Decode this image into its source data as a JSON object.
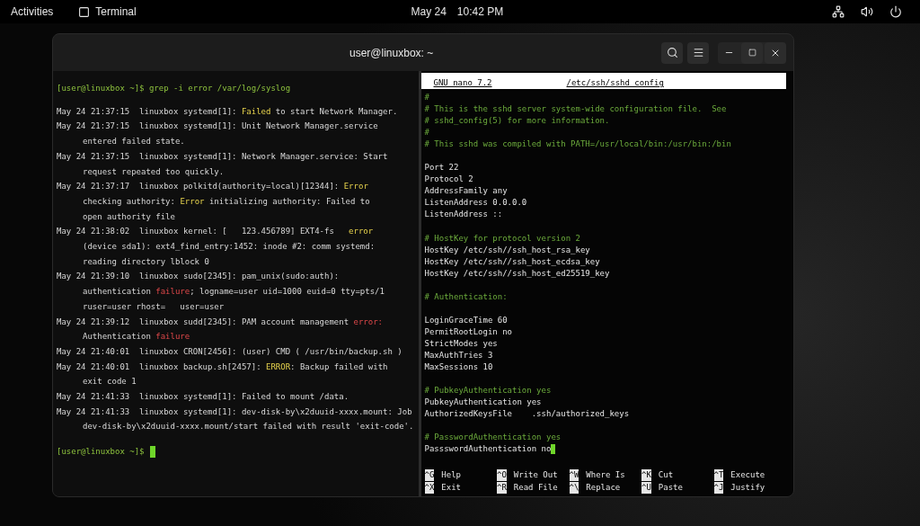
{
  "top_bar": {
    "activities": "Activities",
    "app": "Terminal",
    "date": "May 24",
    "time": "10:42 PM"
  },
  "window": {
    "title": "user@linuxbox: ~"
  },
  "left_pane": {
    "command_prompt": "[user@linuxbox ~]$",
    "command": "grep -i error /var/log/syslog",
    "log_lines": [
      {
        "indent": false,
        "segments": [
          {
            "text": "May 24 21:37:15  linuxbox systemd[1]: ",
            "kind": "plain"
          },
          {
            "text": "Failed",
            "kind": "warning"
          },
          {
            "text": " to start Network Manager.",
            "kind": "plain"
          }
        ]
      },
      {
        "indent": false,
        "segments": [
          {
            "text": "May 24 21:37:15  linuxbox systemd[1]: Unit Network Manager.service",
            "kind": "plain"
          }
        ]
      },
      {
        "indent": true,
        "segments": [
          {
            "text": "entered failed state.",
            "kind": "plain"
          }
        ]
      },
      {
        "indent": false,
        "segments": [
          {
            "text": "May 24 21:37:15  linuxbox systemd[1]: Network Manager.service: Start",
            "kind": "plain"
          }
        ]
      },
      {
        "indent": true,
        "segments": [
          {
            "text": "request repeated too quickly.",
            "kind": "plain"
          }
        ]
      },
      {
        "indent": false,
        "segments": [
          {
            "text": "May 24 21:37:17  linuxbox polkitd(authority=local)[12344]: ",
            "kind": "plain"
          },
          {
            "text": "Error",
            "kind": "warning"
          }
        ]
      },
      {
        "indent": true,
        "segments": [
          {
            "text": "checking authority: ",
            "kind": "plain"
          },
          {
            "text": "Error",
            "kind": "warning"
          },
          {
            "text": " initializing authority: Failed to",
            "kind": "plain"
          }
        ]
      },
      {
        "indent": true,
        "segments": [
          {
            "text": "open authority file",
            "kind": "plain"
          }
        ]
      },
      {
        "indent": false,
        "segments": [
          {
            "text": "May 24 21:38:02  linuxbox kernel: [   123.456789] EXT4-fs   ",
            "kind": "plain"
          },
          {
            "text": "error",
            "kind": "warning"
          }
        ]
      },
      {
        "indent": true,
        "segments": [
          {
            "text": "(device sda1): ext4_find_entry:1452: inode #2: comm systemd:",
            "kind": "plain"
          }
        ]
      },
      {
        "indent": true,
        "segments": [
          {
            "text": "reading directory lblock 0",
            "kind": "plain"
          }
        ]
      },
      {
        "indent": false,
        "segments": [
          {
            "text": "May 24 21:39:10  linuxbox sudo[2345]: pam_unix(sudo:auth):",
            "kind": "plain"
          }
        ]
      },
      {
        "indent": true,
        "segments": [
          {
            "text": "authentication ",
            "kind": "plain"
          },
          {
            "text": "failure",
            "kind": "error"
          },
          {
            "text": "; logname=user uid=1000 euid=0 tty=pts/1",
            "kind": "plain"
          }
        ]
      },
      {
        "indent": true,
        "segments": [
          {
            "text": "ruser=user rhost=   user=user",
            "kind": "plain"
          }
        ]
      },
      {
        "indent": false,
        "segments": [
          {
            "text": "May 24 21:39:12  linuxbox sudd[2345]: PAM account management ",
            "kind": "plain"
          },
          {
            "text": "error:",
            "kind": "error"
          }
        ]
      },
      {
        "indent": true,
        "segments": [
          {
            "text": "Authentication ",
            "kind": "plain"
          },
          {
            "text": "failure",
            "kind": "error"
          }
        ]
      },
      {
        "indent": false,
        "segments": [
          {
            "text": "May 24 21:40:01  linuxbox CRON[2456]: (user) CMD ( /usr/bin/backup.sh )",
            "kind": "plain"
          }
        ]
      },
      {
        "indent": false,
        "segments": [
          {
            "text": "May 24 21:40:01  linuxbox backup.sh[2457]: ",
            "kind": "plain"
          },
          {
            "text": "ERROR",
            "kind": "warning"
          },
          {
            "text": ": Backup failed with",
            "kind": "plain"
          }
        ]
      },
      {
        "indent": true,
        "segments": [
          {
            "text": "exit code 1",
            "kind": "plain"
          }
        ]
      },
      {
        "indent": false,
        "segments": [
          {
            "text": "May 24 21:41:33  linuxbox systemd[1]: Failed to mount /data.",
            "kind": "plain"
          }
        ]
      },
      {
        "indent": false,
        "segments": [
          {
            "text": "May 24 21:41:33  linuxbox systemd[1]: dev-disk-by\\x2duuid-xxxx.mount: Job",
            "kind": "plain"
          }
        ]
      },
      {
        "indent": true,
        "segments": [
          {
            "text": "dev-disk-by\\x2duuid-xxxx.mount/start failed with result 'exit-code'.",
            "kind": "plain"
          }
        ]
      }
    ],
    "final_prompt": "[user@linuxbox ~]$"
  },
  "right_pane": {
    "editor": "GNU nano 7.2",
    "file": "/etc/ssh/sshd_config",
    "lines": [
      {
        "kind": "comment",
        "text": "#"
      },
      {
        "kind": "comment",
        "text": "# This is the sshd server system-wide configuration file.  See"
      },
      {
        "kind": "comment",
        "text": "# sshd_config(5) for more information."
      },
      {
        "kind": "comment",
        "text": "#"
      },
      {
        "kind": "comment",
        "text": "# This sshd was compiled with PATH=/usr/local/bin:/usr/bin:/bin"
      },
      {
        "kind": "blank"
      },
      {
        "kind": "setting",
        "text": "Port 22"
      },
      {
        "kind": "setting",
        "text": "Protocol 2"
      },
      {
        "kind": "setting",
        "text": "AddressFamily any"
      },
      {
        "kind": "setting",
        "text": "ListenAddress 0.0.0.0"
      },
      {
        "kind": "setting",
        "text": "ListenAddress ::"
      },
      {
        "kind": "blank"
      },
      {
        "kind": "comment",
        "text": "# HostKey for protocol version 2"
      },
      {
        "kind": "setting",
        "text": "HostKey /etc/ssh//ssh_host_rsa_key"
      },
      {
        "kind": "setting",
        "text": "HostKey /etc/ssh//ssh_host_ecdsa_key"
      },
      {
        "kind": "setting",
        "text": "HostKey /etc/ssh//ssh_host_ed25519_key"
      },
      {
        "kind": "blank"
      },
      {
        "kind": "comment",
        "text": "# Authentication:"
      },
      {
        "kind": "blank"
      },
      {
        "kind": "setting",
        "text": "LoginGraceTime 60"
      },
      {
        "kind": "setting",
        "text": "PermitRootLogin no"
      },
      {
        "kind": "setting",
        "text": "StrictModes yes"
      },
      {
        "kind": "setting",
        "text": "MaxAuthTries 3"
      },
      {
        "kind": "setting",
        "text": "MaxSessions 10"
      },
      {
        "kind": "blank"
      },
      {
        "kind": "comment",
        "text": "# PubkeyAuthentication yes"
      },
      {
        "kind": "setting",
        "text": "PubkeyAuthentication yes"
      },
      {
        "kind": "setting",
        "text": "AuthorizedKeysFile    .ssh/authorized_keys"
      },
      {
        "kind": "blank"
      },
      {
        "kind": "comment",
        "text": "# PasswordAuthentication yes"
      },
      {
        "kind": "cursor",
        "text": "PassswordAuthentication no"
      }
    ],
    "shortcuts": [
      [
        {
          "key": "^G",
          "label": "Help"
        },
        {
          "key": "^O",
          "label": "Write Out"
        },
        {
          "key": "^W",
          "label": "Where Is"
        },
        {
          "key": "^K",
          "label": "Cut"
        },
        {
          "key": "^T",
          "label": "Execute"
        }
      ],
      [
        {
          "key": "^X",
          "label": "Exit"
        },
        {
          "key": "^R",
          "label": "Read File"
        },
        {
          "key": "^\\",
          "label": "Replace"
        },
        {
          "key": "^U",
          "label": "Paste"
        },
        {
          "key": "^J",
          "label": "Justify"
        }
      ]
    ]
  }
}
